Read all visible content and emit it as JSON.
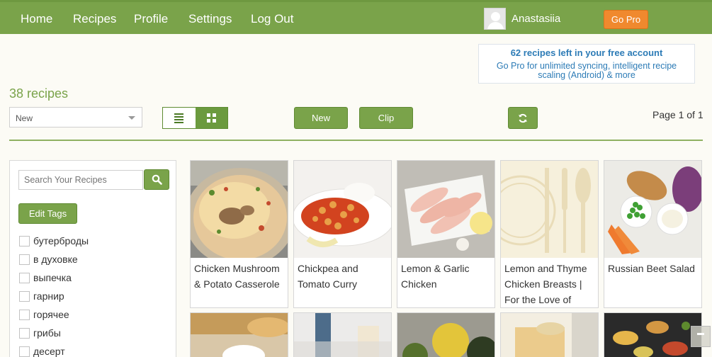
{
  "nav": {
    "items": [
      "Home",
      "Recipes",
      "Profile",
      "Settings",
      "Log Out"
    ],
    "username": "Anastasiia",
    "gopro_label": "Go Pro"
  },
  "promo": {
    "title": "62 recipes left in your free account",
    "text": "Go Pro for unlimited syncing, intelligent recipe scaling (Android) & more"
  },
  "toolbar": {
    "recipe_count": "38 recipes",
    "sort_value": "New",
    "new_label": "New",
    "clip_label": "Clip",
    "page_info": "Page 1 of 1"
  },
  "sidebar": {
    "search_placeholder": "Search Your Recipes",
    "edit_tags_label": "Edit Tags",
    "tags": [
      "бутерброды",
      "в духовке",
      "выпечка",
      "гарнир",
      "горячее",
      "грибы",
      "десерт"
    ]
  },
  "recipes": [
    {
      "title": "Chicken Mushroom & Potato Casserole"
    },
    {
      "title": "Chickpea and Tomato Curry"
    },
    {
      "title": "Lemon & Garlic Chicken"
    },
    {
      "title": "Lemon and Thyme Chicken Breasts | For the Love of"
    },
    {
      "title": "Russian Beet Salad"
    }
  ],
  "colors": {
    "brand_green": "#7aa34a",
    "accent_orange": "#f0892e",
    "link_blue": "#2c7bb6"
  }
}
